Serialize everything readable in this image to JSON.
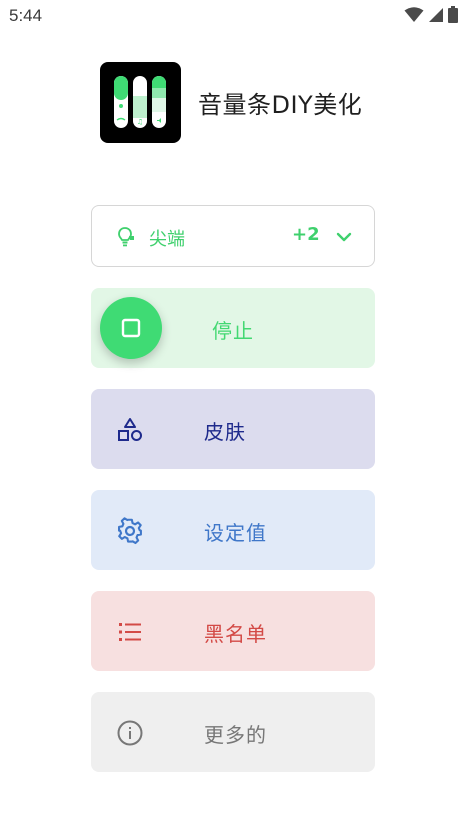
{
  "status_bar": {
    "time": "5:44"
  },
  "app": {
    "title": "音量条DIY美化"
  },
  "mode_select": {
    "label": "尖端",
    "extra": "+2",
    "accent": "#3fd06d",
    "icon": "lightbulb-icon"
  },
  "actions": {
    "stop": {
      "label": "停止",
      "icon": "stop-square-icon",
      "color": "#43d872"
    },
    "skin": {
      "label": "皮肤",
      "icon": "shapes-icon",
      "color": "#1e2a8c"
    },
    "settings": {
      "label": "设定值",
      "icon": "gear-icon",
      "color": "#3f77c9"
    },
    "blacklist": {
      "label": "黑名单",
      "icon": "list-icon",
      "color": "#d34a46"
    },
    "more": {
      "label": "更多的",
      "icon": "info-icon",
      "color": "#777777"
    }
  }
}
